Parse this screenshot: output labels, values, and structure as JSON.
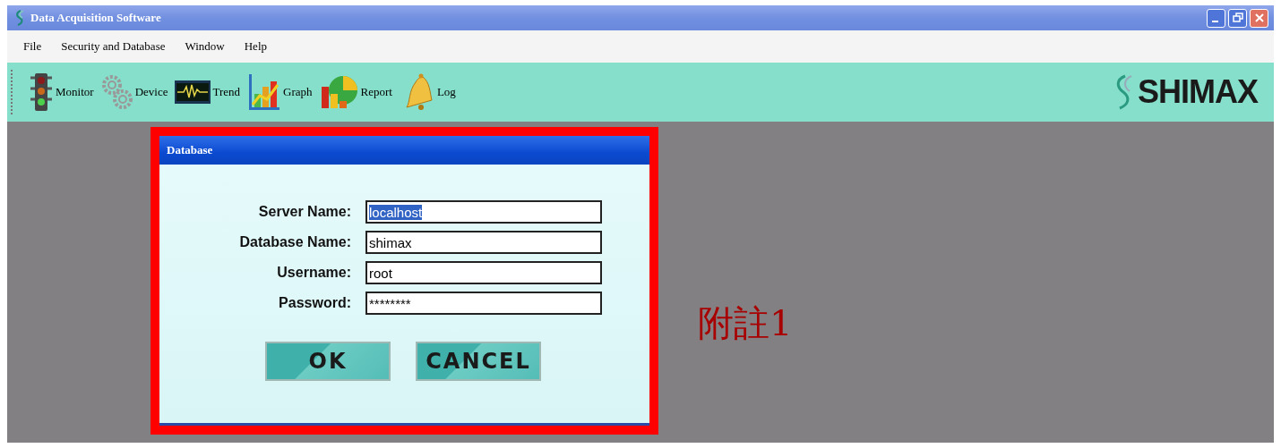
{
  "window": {
    "title": "Data Acquisition Software"
  },
  "menu": [
    "File",
    "Security and Database",
    "Window",
    "Help"
  ],
  "toolbar": [
    {
      "kind": "traffic",
      "label": "Monitor"
    },
    {
      "kind": "gears",
      "label": "Device"
    },
    {
      "kind": "wave",
      "label": "Trend"
    },
    {
      "kind": "chart",
      "label": "Graph"
    },
    {
      "kind": "pie",
      "label": "Report"
    },
    {
      "kind": "bell",
      "label": "Log"
    }
  ],
  "brand": "SHIMAX",
  "dialog": {
    "title": "Database",
    "fields": [
      {
        "label": "Server Name:",
        "value": "localhost",
        "selected": true
      },
      {
        "label": "Database Name:",
        "value": "shimax",
        "selected": false
      },
      {
        "label": "Username:",
        "value": "root",
        "selected": false
      },
      {
        "label": "Password:",
        "value": "********",
        "selected": false
      }
    ],
    "buttons": [
      "OK",
      "CANCEL"
    ]
  },
  "annotation": "附註1"
}
